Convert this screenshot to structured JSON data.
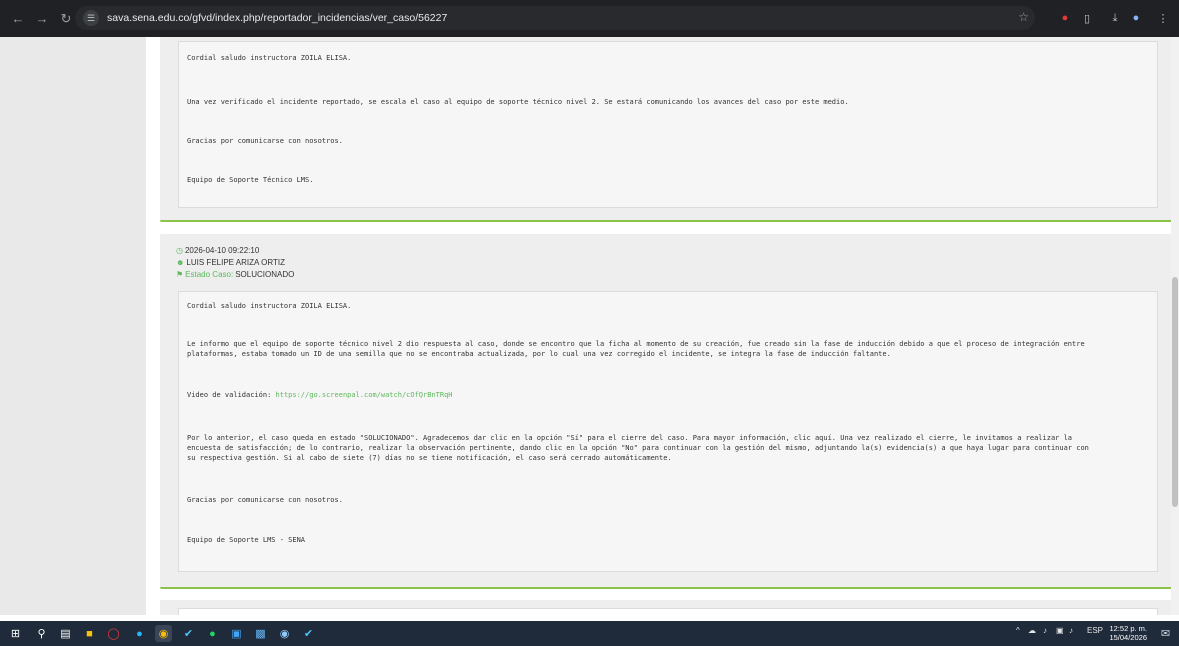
{
  "browser": {
    "url": "sava.sena.edu.co/gfvd/index.php/reportador_incidencias/ver_caso/56227"
  },
  "message1": {
    "greeting": "Cordial saludo instructora ZOILA ELISA.",
    "body": "Una vez verificado el incidente reportado, se escala el caso al equipo de soporte técnico nivel 2. Se estará comunicando los avances del caso por este medio.",
    "thanks": "Gracias por comunicarse con nosotros.",
    "signature": "Equipo de Soporte Técnico LMS."
  },
  "message2": {
    "date": "2026-04-10 09:22:10",
    "author": "LUIS FELIPE ARIZA ORTIZ",
    "status_label": "Estado Caso:",
    "status_value": "SOLUCIONADO",
    "greeting": "Cordial saludo instructora ZOILA ELISA.",
    "body_line1": "Le informo que el equipo de soporte técnico nivel 2 dio respuesta al caso, donde se encontro que la ficha al momento de su creación, fue creado sin la fase de inducción debido a que el proceso de integración entre",
    "body_line2": "plataformas, estaba tomado un ID de una semilla que no se encontraba actualizada, por lo cual una vez corregido el incidente, se integra la fase de inducción faltante.",
    "video_label": "Video de validación:",
    "video_link": "https://go.screenpal.com/watch/cOfQrBnTRqH",
    "closing_line1": "Por lo anterior, el caso queda en estado \"SOLUCIONADO\". Agradecemos dar clic en la opción \"Sí\" para el cierre del caso. Para mayor información, clic aquí. Una vez realizado el cierre, le invitamos a realizar la",
    "closing_line2": "encuesta de satisfacción; de lo contrario, realizar la observación pertinente, dando clic en la opción \"No\" para continuar con la gestión del mismo, adjuntando la(s) evidencia(s) a que haya lugar para continuar con",
    "closing_line3": "su respectiva gestión. Si al cabo de siete (7) días no se tiene notificación, el caso será cerrado automáticamente.",
    "thanks": "Gracias por comunicarse con nosotros.",
    "signature": "Equipo de Soporte LMS - SENA"
  },
  "taskbar": {
    "language": "ESP",
    "time": "12:52 p. m.",
    "date": "15/04/2026"
  },
  "colors": {
    "accent_green": "#5cb85c",
    "card_border": "#8bc34a"
  }
}
